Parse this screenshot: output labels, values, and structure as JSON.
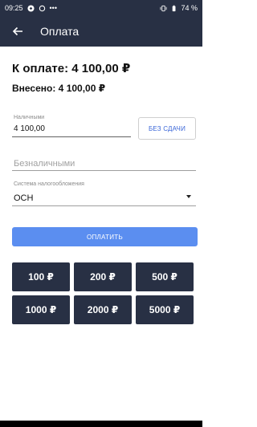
{
  "status": {
    "time": "09:25",
    "dots": "•••",
    "battery": "74 %"
  },
  "header": {
    "title": "Оплата"
  },
  "summary": {
    "to_pay": "К оплате: 4 100,00 ₽",
    "paid": "Внесено: 4 100,00 ₽"
  },
  "cash": {
    "label": "Наличными",
    "value": "4 100,00",
    "no_change_label": "БЕЗ СДАЧИ"
  },
  "cashless": {
    "placeholder": "Безналичными"
  },
  "tax": {
    "label": "Система налогообложения",
    "value": "ОСН"
  },
  "pay_button": "ОПЛАТИТЬ",
  "quick_amounts": [
    "100 ₽",
    "200 ₽",
    "500 ₽",
    "1000 ₽",
    "2000 ₽",
    "5000 ₽"
  ],
  "colors": {
    "header_bg": "#283044",
    "accent": "#5b8ef0",
    "link": "#3a66d8"
  }
}
